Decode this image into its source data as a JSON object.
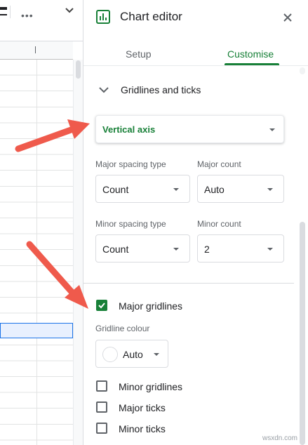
{
  "editor": {
    "title": "Chart editor",
    "tabs": [
      {
        "label": "Setup",
        "active": false
      },
      {
        "label": "Customise",
        "active": true
      }
    ],
    "section_title": "Gridlines and ticks",
    "axis_select": {
      "value": "Vertical axis"
    },
    "major_spacing": {
      "label": "Major spacing type",
      "value": "Count"
    },
    "major_count": {
      "label": "Major count",
      "value": "Auto"
    },
    "minor_spacing": {
      "label": "Minor spacing type",
      "value": "Count"
    },
    "minor_count": {
      "label": "Minor count",
      "value": "2"
    },
    "major_gridlines": {
      "label": "Major gridlines",
      "checked": true
    },
    "gridline_colour": {
      "label": "Gridline colour",
      "value": "Auto"
    },
    "minor_gridlines": {
      "label": "Minor gridlines",
      "checked": false
    },
    "major_ticks": {
      "label": "Major ticks",
      "checked": false
    },
    "minor_ticks": {
      "label": "Minor ticks",
      "checked": false
    }
  },
  "watermark": "wsxdn.com",
  "colors": {
    "accent": "#188038",
    "arrow": "#ef5a4c"
  }
}
